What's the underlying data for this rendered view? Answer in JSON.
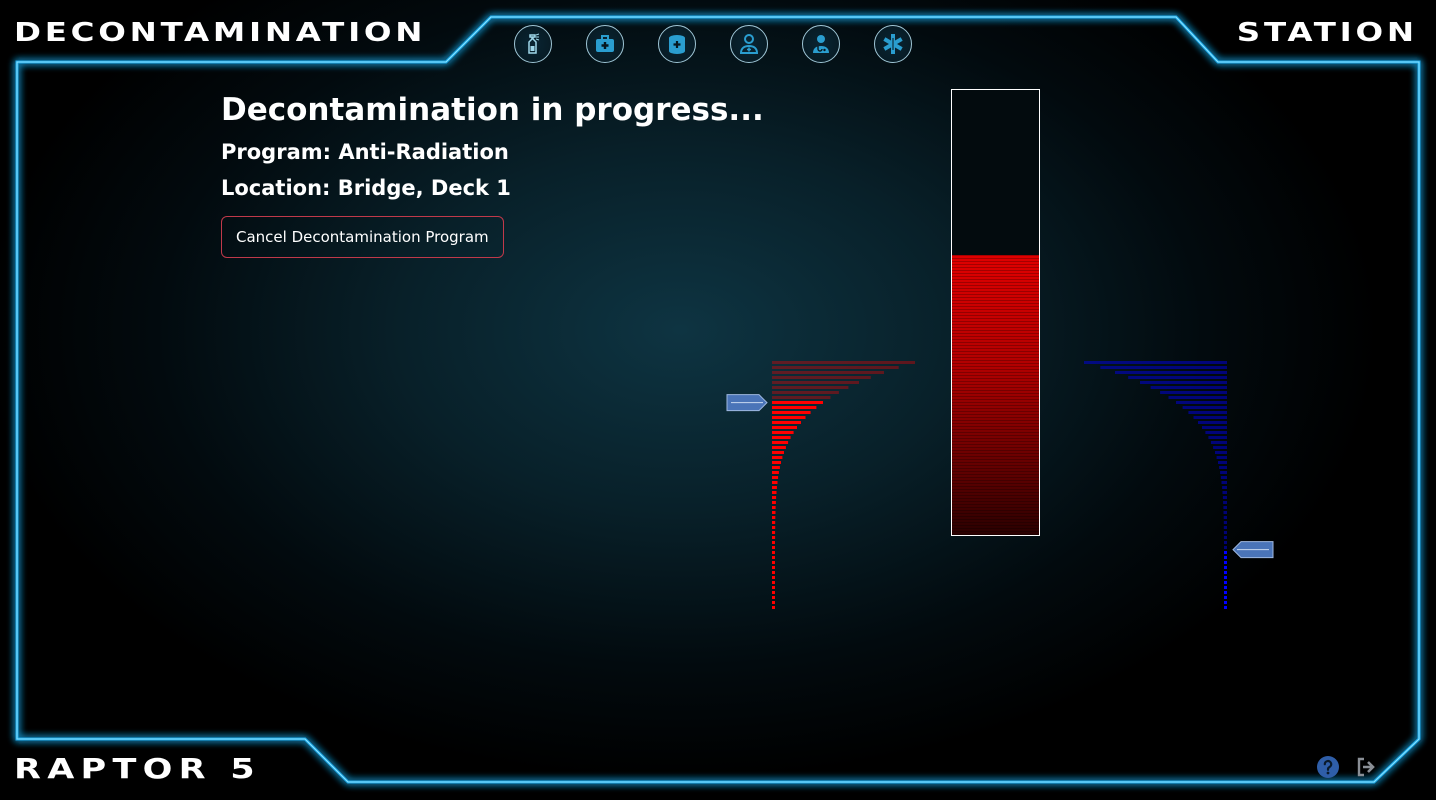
{
  "header": {
    "title_left": "DECONTAMINATION",
    "title_right": "STATION"
  },
  "footer": {
    "ship_name": "RAPTOR 5"
  },
  "nav_icons": [
    "spray-bottle-icon",
    "first-aid-kit-icon",
    "medicine-canister-icon",
    "patient-icon",
    "doctor-icon",
    "medical-star-icon"
  ],
  "status": {
    "heading": "Decontamination in progress...",
    "program": "Program: Anti-Radiation",
    "location": "Location: Bridge, Deck 1",
    "cancel_label": "Cancel Decontamination Program"
  },
  "progress": {
    "fill_fraction": 0.63,
    "color": "#e00000"
  },
  "gauges": {
    "left_color": "#ff0000",
    "right_color": "#0000ff",
    "left_marker_fraction": 0.83,
    "right_marker_fraction": 0.23
  },
  "colors": {
    "frame_glow": "#1aa8e8",
    "frame_line": "#5fd4ff",
    "cancel_border": "#c0394a",
    "marker_fill": "#4a74b8"
  },
  "footer_icons": [
    "help-icon",
    "logout-icon"
  ]
}
